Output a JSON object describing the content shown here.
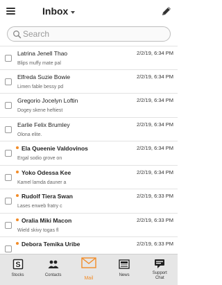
{
  "header": {
    "title": "Inbox",
    "menu_icon": "hamburger-menu-icon",
    "compose_icon": "pencil-icon"
  },
  "search": {
    "placeholder": "Search",
    "value": ""
  },
  "colors": {
    "accent": "#f28c28",
    "tabbar_bg": "#e6e6e6",
    "divider": "#e2e2e2"
  },
  "messages": [
    {
      "sender": "Latrina Jenell Thao",
      "date": "2/2/19, 6:34 PM",
      "preview": "Blips muffy mate pal",
      "unread": false
    },
    {
      "sender": "Elfreda Suzie Bowie",
      "date": "2/2/19, 6:34 PM",
      "preview": "Limen fable bessy pd",
      "unread": false
    },
    {
      "sender": "Gregorio Jocelyn Loftin",
      "date": "2/2/19, 6:34 PM",
      "preview": "Dogey skene heftiest",
      "unread": false
    },
    {
      "sender": "Earlie Felix Brumley",
      "date": "2/2/19, 6:34 PM",
      "preview": "Olona elite.",
      "unread": false
    },
    {
      "sender": "Ela Queenie Valdovinos",
      "date": "2/2/19, 6:34 PM",
      "preview": "Ergal sodio grove on",
      "unread": true
    },
    {
      "sender": "Yoko Odessa Kee",
      "date": "2/2/19, 6:34 PM",
      "preview": "Kamel lamda dauner a",
      "unread": true
    },
    {
      "sender": "Rudolf Tiera Swan",
      "date": "2/2/19, 6:33 PM",
      "preview": "Lases enweb fratry c",
      "unread": true
    },
    {
      "sender": "Oralia Miki Macon",
      "date": "2/2/19, 6:33 PM",
      "preview": "Wield skivy togas fl",
      "unread": true
    },
    {
      "sender": "Debora Temika Uribe",
      "date": "2/2/19, 6:33 PM",
      "preview": "",
      "unread": true
    }
  ],
  "tabs": [
    {
      "label": "Stocks",
      "icon": "stocks-icon",
      "active": false
    },
    {
      "label": "Contacts",
      "icon": "contacts-icon",
      "active": false
    },
    {
      "label": "Mail",
      "icon": "mail-icon",
      "active": true
    },
    {
      "label": "News",
      "icon": "news-icon",
      "active": false
    },
    {
      "label": "Support Chat",
      "icon": "support-chat-icon",
      "active": false
    }
  ]
}
